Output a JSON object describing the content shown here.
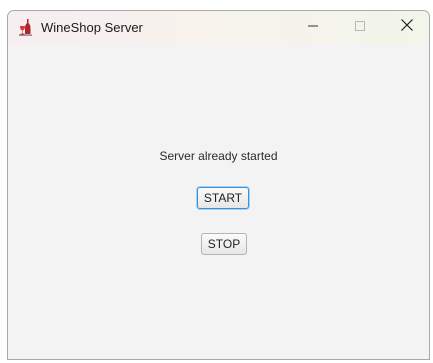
{
  "window": {
    "title": "WineShop Server",
    "icon": "wine-bottle-glass-icon",
    "controls": {
      "minimize_icon": "minimize-icon",
      "maximize_icon": "maximize-icon",
      "close_icon": "close-icon"
    }
  },
  "main": {
    "status_message": "Server already started",
    "start_label": "START",
    "stop_label": "STOP"
  },
  "colors": {
    "focus_ring": "#3a8fd6",
    "icon_red": "#b3252d",
    "window_bg": "#f3f3f3"
  }
}
